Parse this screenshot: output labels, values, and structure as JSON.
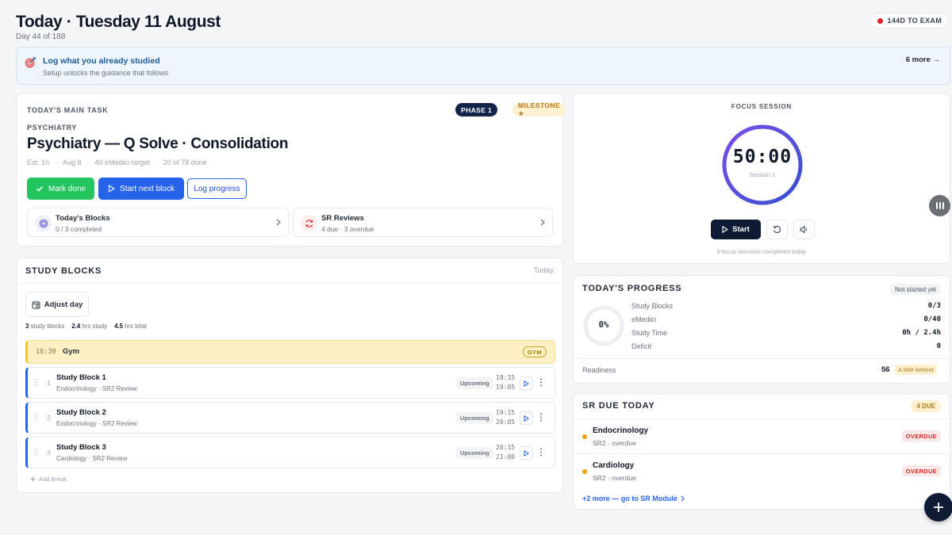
{
  "header": {
    "title": "Today · Tuesday 11 August",
    "day_progress": "Day 44 of 188",
    "exam_countdown": "144D TO EXAM"
  },
  "banner": {
    "title": "Log what you already studied",
    "subtitle": "Setup unlocks the guidance that follows",
    "more": "6 more →"
  },
  "main_task": {
    "eyebrow": "TODAY'S MAIN TASK",
    "phase": "PHASE 1",
    "milestone": "MILESTONE ★",
    "subject": "PSYCHIATRY",
    "title": "Psychiatry — Q Solve · Consolidation",
    "meta": [
      "Est. 1h",
      "Aug 8",
      "40 eMedici target",
      "20 of 78 done"
    ],
    "buttons": {
      "done": "Mark done",
      "next": "Start next block",
      "log": "Log progress"
    },
    "blocks_card": {
      "title": "Today's Blocks",
      "sub": "0 / 3 completed"
    },
    "sr_card": {
      "title": "SR Reviews",
      "sub": "4 due · 3 overdue"
    }
  },
  "study_blocks": {
    "title": "STUDY BLOCKS",
    "today": "Today",
    "adjust": "Adjust day",
    "stats": [
      {
        "value": "3",
        "label": "study blocks"
      },
      {
        "value": "2.4",
        "label": "hrs study"
      },
      {
        "value": "4.5",
        "label": "hrs total"
      }
    ],
    "gym": {
      "time": "16:30",
      "name": "Gym",
      "tag": "GYM"
    },
    "blocks": [
      {
        "num": "1",
        "name": "Study Block 1",
        "sub": "Endocrinology · SR2 Review",
        "status": "Upcoming",
        "start": "18:15",
        "end": "19:05"
      },
      {
        "num": "2",
        "name": "Study Block 2",
        "sub": "Endocrinology · SR2 Review",
        "status": "Upcoming",
        "start": "19:15",
        "end": "20:05"
      },
      {
        "num": "3",
        "name": "Study Block 3",
        "sub": "Cardiology · SR2 Review",
        "status": "Upcoming",
        "start": "20:15",
        "end": "21:00"
      }
    ],
    "add_break": "Add Break"
  },
  "focus": {
    "label": "FOCUS SESSION",
    "time": "50:00",
    "session": "Session 1",
    "start": "Start",
    "footer": "0 focus sessions completed today"
  },
  "progress": {
    "title": "TODAY'S PROGRESS",
    "status": "Not started yet",
    "percent": "0%",
    "rows": [
      {
        "label": "Study Blocks",
        "value": "0/3"
      },
      {
        "label": "eMedici",
        "value": "0/40"
      },
      {
        "label": "Study Time",
        "value": "0h / 2.4h"
      },
      {
        "label": "Deficit",
        "value": "0"
      }
    ],
    "readiness_label": "Readiness",
    "readiness_value": "56",
    "readiness_badge": "A little behind"
  },
  "sr_due": {
    "title": "SR DUE TODAY",
    "count": "4 DUE",
    "items": [
      {
        "name": "Endocrinology",
        "sub": "SR2 · overdue",
        "badge": "OVERDUE"
      },
      {
        "name": "Cardiology",
        "sub": "SR2 · overdue",
        "badge": "OVERDUE"
      }
    ],
    "link": "+2 more — go to SR Module"
  },
  "colors": {
    "accent_blue": "#2563eb",
    "success_green": "#22c55e",
    "navy": "#0f1b34",
    "warning_amber": "#f59e0b",
    "danger_red": "#dc2626",
    "ring_gradient": [
      "#6d4ee6",
      "#3b5bdb"
    ]
  },
  "icons": {
    "banner": "target-icon",
    "blocks": "layers-icon",
    "sr": "refresh-icon",
    "adjust": "calendar-icon",
    "reset": "rotate-icon",
    "sound": "speaker-icon",
    "fab": "plus-icon",
    "side": "pause-icon"
  }
}
